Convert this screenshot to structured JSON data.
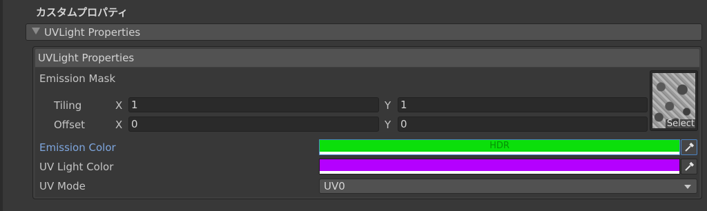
{
  "section_title": "カスタムプロパティ",
  "foldout": {
    "title": "UVLight Properties",
    "arrow_icon": "triangle-down-icon"
  },
  "panel": {
    "title": "UVLight Properties",
    "emission_mask": {
      "label": "Emission Mask",
      "texture_select_label": "Select",
      "tiling": {
        "label": "Tiling",
        "x_label": "X",
        "x": "1",
        "y_label": "Y",
        "y": "1"
      },
      "offset": {
        "label": "Offset",
        "x_label": "X",
        "x": "0",
        "y_label": "Y",
        "y": "0"
      }
    },
    "emission_color": {
      "label": "Emission Color",
      "color": "#0bdf0b",
      "tag": "HDR",
      "picker_icon": "eyedropper-icon"
    },
    "uv_light_color": {
      "label": "UV Light Color",
      "color": "#b400ff",
      "picker_icon": "eyedropper-icon"
    },
    "uv_mode": {
      "label": "UV Mode",
      "value": "UV0",
      "arrow_icon": "caret-down-icon"
    }
  },
  "colors": {
    "background": "#383838",
    "focus_accent": "#4b83c4",
    "highlight_label": "#7ea6de"
  }
}
